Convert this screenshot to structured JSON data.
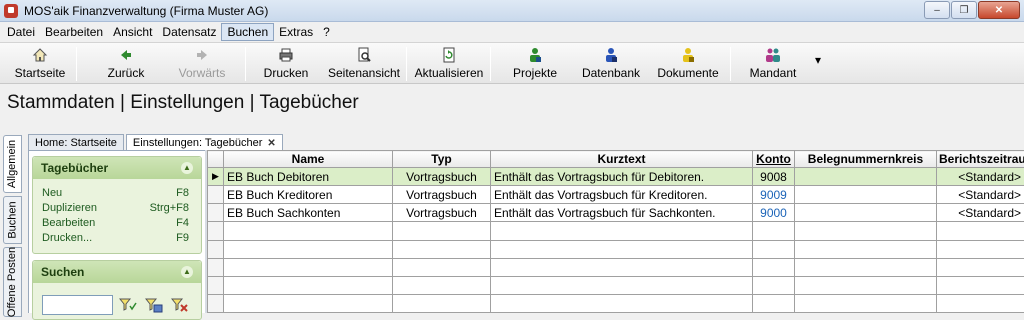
{
  "window": {
    "title": "MOS'aik Finanzverwaltung (Firma Muster AG)",
    "btn_minimize": "–",
    "btn_restore": "❐",
    "btn_close": "✕"
  },
  "menu": [
    "Datei",
    "Bearbeiten",
    "Ansicht",
    "Datensatz",
    "Buchen",
    "Extras",
    "?"
  ],
  "menu_active_index": 4,
  "toolbar": {
    "startseite": "Startseite",
    "zurueck": "Zurück",
    "vorwaerts": "Vorwärts",
    "drucken": "Drucken",
    "seitenansicht": "Seitenansicht",
    "aktualisieren": "Aktualisieren",
    "projekte": "Projekte",
    "datenbank": "Datenbank",
    "dokumente": "Dokumente",
    "mandant": "Mandant",
    "more": "▾"
  },
  "page_title": "Stammdaten | Einstellungen | Tagebücher",
  "vertical_tabs": [
    "Allgemein",
    "Buchen",
    "Offene Posten"
  ],
  "doc_tabs": [
    "Home: Startseite",
    "Einstellungen: Tagebücher"
  ],
  "doc_tab_close": "✕",
  "side": {
    "tagebuecher": {
      "title": "Tagebücher",
      "chevron": "▲",
      "actions": [
        {
          "label": "Neu",
          "key": "F8"
        },
        {
          "label": "Duplizieren",
          "key": "Strg+F8"
        },
        {
          "label": "Bearbeiten",
          "key": "F4"
        },
        {
          "label": "Drucken...",
          "key": "F9"
        }
      ]
    },
    "suchen": {
      "title": "Suchen",
      "chevron": "▲",
      "input_value": ""
    }
  },
  "grid": {
    "columns": [
      "Name",
      "Typ",
      "Kurztext",
      "Konto",
      "Belegnummernkreis",
      "Berichtszeitraum"
    ],
    "indicator": "▶",
    "rows": [
      {
        "name": "EB Buch Debitoren",
        "typ": "Vortragsbuch",
        "kurztext": "Enthält das Vortragsbuch für Debitoren.",
        "konto": "9008",
        "beleg": "",
        "bericht": "<Standard>"
      },
      {
        "name": "EB Buch Kreditoren",
        "typ": "Vortragsbuch",
        "kurztext": "Enthält das Vortragsbuch für Kreditoren.",
        "konto": "9009",
        "beleg": "",
        "bericht": "<Standard>"
      },
      {
        "name": "EB Buch Sachkonten",
        "typ": "Vortragsbuch",
        "kurztext": "Enthält das Vortragsbuch für Sachkonten.",
        "konto": "9000",
        "beleg": "",
        "bericht": "<Standard>"
      }
    ]
  }
}
